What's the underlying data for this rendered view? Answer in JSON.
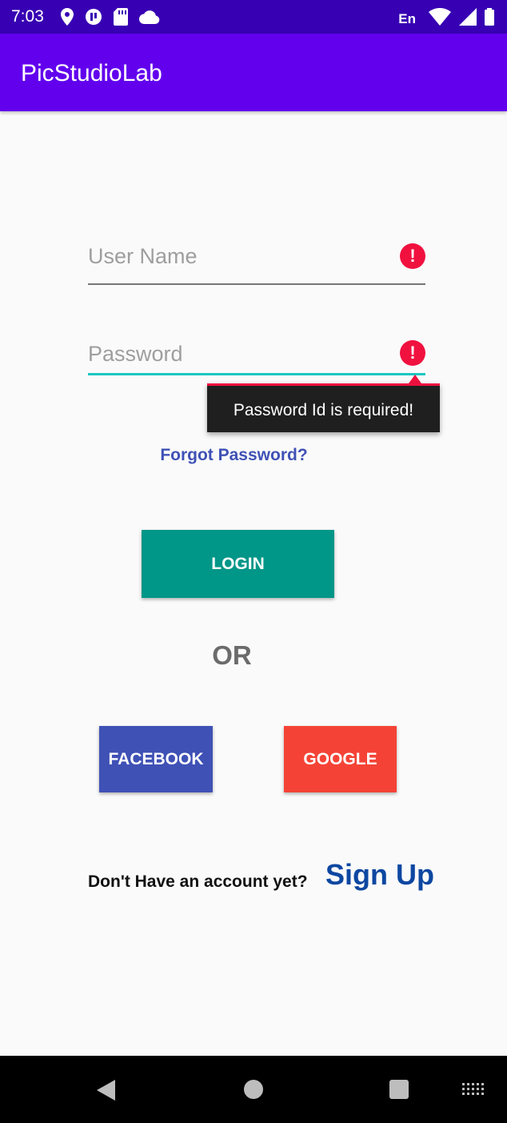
{
  "status_bar": {
    "time": "7:03",
    "lang": "En",
    "icons_left": [
      "location-icon",
      "vpn-key-icon",
      "sd-card-icon",
      "cloud-icon"
    ],
    "icons_right": [
      "wifi-icon",
      "signal-icon",
      "battery-icon"
    ]
  },
  "app_bar": {
    "title": "PicStudioLab"
  },
  "form": {
    "username": {
      "placeholder": "User Name",
      "value": "",
      "error_icon": "error-icon"
    },
    "password": {
      "placeholder": "Password",
      "value": "",
      "error_icon": "error-icon",
      "error_message": "Password Id is required!"
    },
    "forgot_label": "Forgot Password?",
    "login_label": "LOGIN",
    "or_label": "OR",
    "facebook_label": "FACEBOOK",
    "google_label": "GOOGLE",
    "signup_prompt": "Don't Have an account yet?",
    "signup_label": "Sign Up"
  },
  "colors": {
    "status_bar": "#3700b3",
    "app_bar": "#6200ee",
    "error": "#f0113f",
    "focus_underline": "#1bc7c2",
    "login": "#009688",
    "facebook": "#3f51b5",
    "google": "#f44336",
    "signup": "#0d47a1"
  },
  "nav_bar": {
    "icons": [
      "back-icon",
      "home-icon",
      "recents-icon",
      "keyboard-icon"
    ]
  }
}
